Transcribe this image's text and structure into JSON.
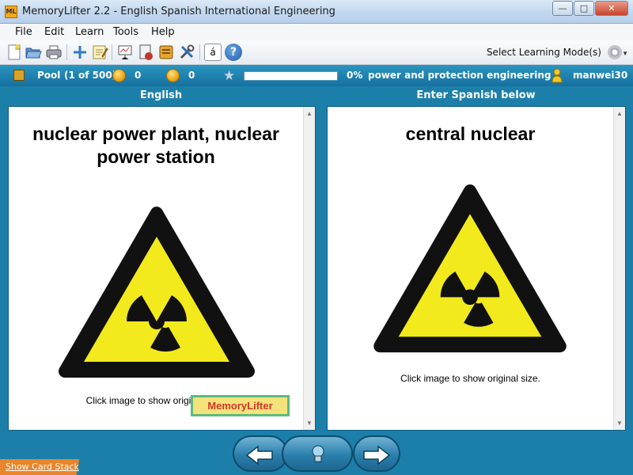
{
  "window": {
    "app_icon": "ML",
    "title": "MemoryLifter 2.2 - English Spanish International Engineering",
    "minimize": "—",
    "maximize": "□",
    "close": "✕"
  },
  "menu": [
    "File",
    "Edit",
    "Learn",
    "Tools",
    "Help"
  ],
  "toolbar": {
    "icons": [
      "new-icon",
      "open-icon",
      "print-icon",
      "add-icon",
      "edit-icon",
      "presentation-icon",
      "statistics-icon",
      "module-icon",
      "tools-icon",
      "character-map-icon",
      "help-icon"
    ],
    "char_button": "á",
    "help_button": "?",
    "mode_label": "Select Learning Mode(s)"
  },
  "status": {
    "box_label": "Pool",
    "box_count": "(1 of 500)",
    "known_count": "0",
    "unknown_count": "0",
    "progress_percent": 0,
    "progress_text": "0%",
    "chapter": "power and protection engineering",
    "user": "manwei30"
  },
  "question_panel": {
    "header": "English",
    "title": "nuclear power plant, nuclear power station",
    "caption": "Click image to show original size."
  },
  "answer_panel": {
    "header": "Enter Spanish below",
    "title": "central nuclear",
    "caption": "Click image to show original size."
  },
  "logo_text": "MemoryLifter",
  "nav": {
    "back_icon": "left-arrow-icon",
    "hint_icon": "lightbulb-icon",
    "next_icon": "right-arrow-icon"
  },
  "show_card_stack": "Show Card Stack"
}
